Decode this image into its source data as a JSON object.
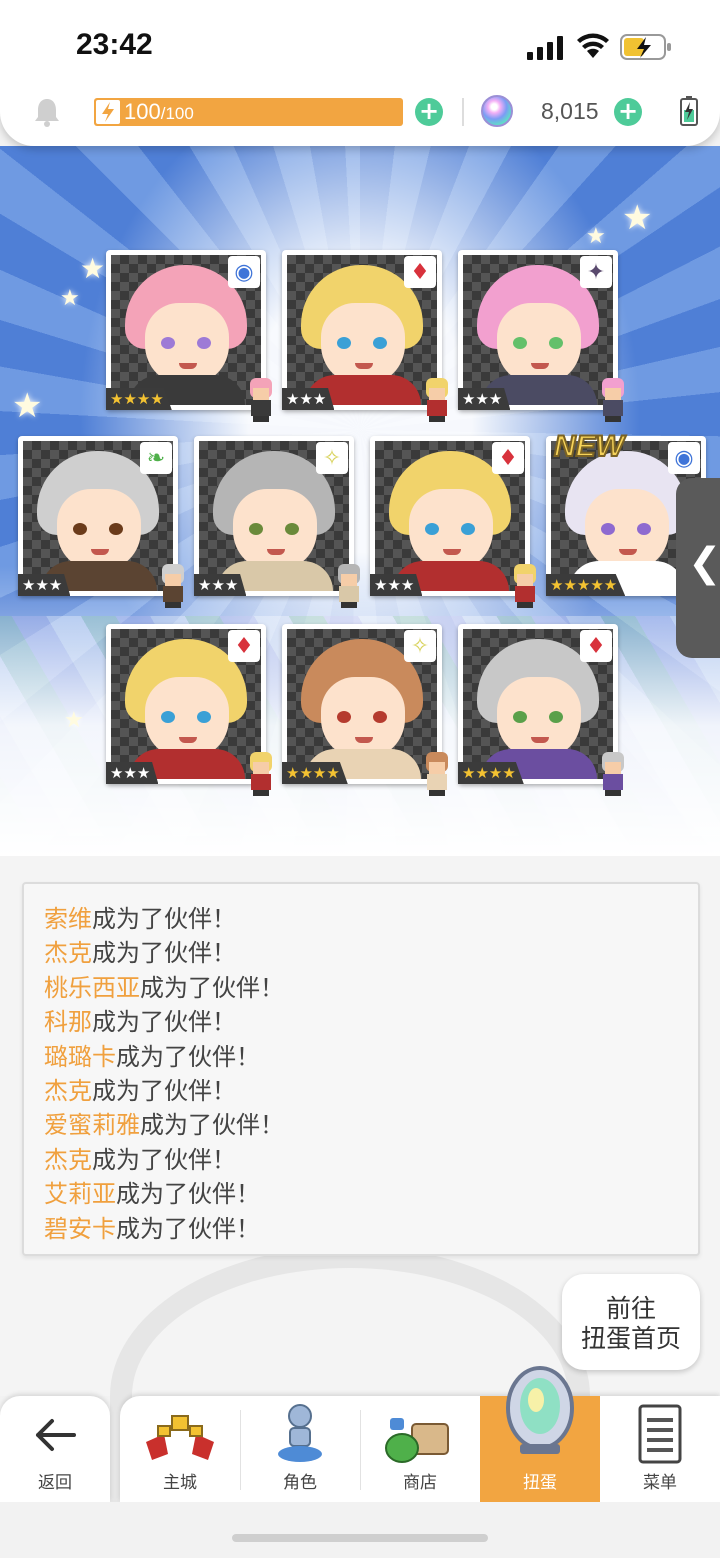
{
  "status_bar": {
    "time": "23:42"
  },
  "resources": {
    "stamina_current": "100",
    "stamina_max": "/100",
    "gems": "8,015"
  },
  "cards": [
    {
      "id": "c1",
      "stars": "★★★★",
      "star_color": "gold",
      "attr": "water",
      "hair": "#f4a3b8",
      "eye": "#9d7ad6",
      "cloth": "#3a3a3a"
    },
    {
      "id": "c2",
      "stars": "★★★",
      "star_color": "silver",
      "attr": "fire",
      "hair": "#f1d36b",
      "eye": "#3aa0d6",
      "cloth": "#b22f2f"
    },
    {
      "id": "c3",
      "stars": "★★★",
      "star_color": "silver",
      "attr": "dark",
      "hair": "#f2a0cf",
      "eye": "#64c06a",
      "cloth": "#4b4b63"
    },
    {
      "id": "c4",
      "stars": "★★★",
      "star_color": "silver",
      "attr": "wind",
      "hair": "#cfcfcf",
      "eye": "#6b3b1a",
      "cloth": "#5b4432"
    },
    {
      "id": "c5",
      "stars": "★★★",
      "star_color": "silver",
      "attr": "light",
      "hair": "#b5b5b5",
      "eye": "#6a8a3a",
      "cloth": "#d9c8a8"
    },
    {
      "id": "c6",
      "stars": "★★★",
      "star_color": "silver",
      "attr": "fire",
      "hair": "#f1d36b",
      "eye": "#3aa0d6",
      "cloth": "#b22f2f"
    },
    {
      "id": "c7",
      "stars": "★★★★★",
      "star_color": "gold",
      "attr": "water",
      "hair": "#e8e4f2",
      "eye": "#8e6ad0",
      "cloth": "#ffffff",
      "new_label": "NEW"
    },
    {
      "id": "c8",
      "stars": "★★★",
      "star_color": "silver",
      "attr": "fire",
      "hair": "#f1d36b",
      "eye": "#3aa0d6",
      "cloth": "#b22f2f"
    },
    {
      "id": "c9",
      "stars": "★★★★",
      "star_color": "gold",
      "attr": "light",
      "hair": "#c98a5c",
      "eye": "#b53b2e",
      "cloth": "#e9d3b4"
    },
    {
      "id": "c10",
      "stars": "★★★★",
      "star_color": "gold",
      "attr": "fire",
      "hair": "#c8c8c8",
      "eye": "#5aa04a",
      "cloth": "#6b4ea0"
    }
  ],
  "attr_icons": {
    "water": "◉",
    "fire": "♦",
    "dark": "✦",
    "wind": "❧",
    "light": "✧"
  },
  "attr_colors": {
    "water": "#3f74d8",
    "fire": "#d8323c",
    "dark": "#5a4a6e",
    "wind": "#4fb04a",
    "light": "#d8d25a"
  },
  "log": [
    {
      "name": "索维",
      "text": "成为了伙伴！"
    },
    {
      "name": "杰克",
      "text": "成为了伙伴！"
    },
    {
      "name": "桃乐西亚",
      "text": "成为了伙伴！"
    },
    {
      "name": "科那",
      "text": "成为了伙伴！"
    },
    {
      "name": "璐璐卡",
      "text": "成为了伙伴！"
    },
    {
      "name": "杰克",
      "text": "成为了伙伴！"
    },
    {
      "name": "爱蜜莉雅",
      "text": "成为了伙伴！"
    },
    {
      "name": "杰克",
      "text": "成为了伙伴！"
    },
    {
      "name": "艾莉亚",
      "text": "成为了伙伴！"
    },
    {
      "name": "碧安卡",
      "text": "成为了伙伴！"
    }
  ],
  "goto_button": {
    "line1": "前往",
    "line2": "扭蛋首页"
  },
  "nav": {
    "back": "返回",
    "items": [
      {
        "label": "主城",
        "icon": "castle-icon"
      },
      {
        "label": "角色",
        "icon": "character-icon"
      },
      {
        "label": "商店",
        "icon": "shop-icon"
      },
      {
        "label": "扭蛋",
        "icon": "gacha-icon",
        "active": true
      },
      {
        "label": "菜单",
        "icon": "menu-icon"
      }
    ]
  },
  "colors": {
    "accent": "#f2a541",
    "name_highlight": "#f0a03e",
    "plus": "#4ecb99"
  }
}
